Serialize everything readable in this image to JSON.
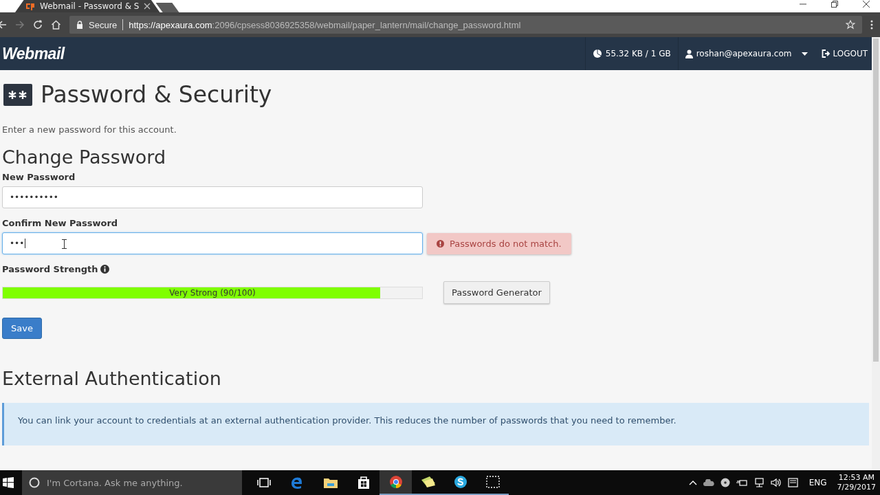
{
  "browser": {
    "tab_title": "Webmail - Password & S",
    "secure_label": "Secure",
    "url_host": "https://apexaura.com",
    "url_rest": ":2096/cpsess8036925358/webmail/paper_lantern/mail/change_password.html"
  },
  "header": {
    "logo": "Webmail",
    "quota": "55.32 KB / 1 GB",
    "user": "roshan@apexaura.com",
    "logout": "LOGOUT"
  },
  "page": {
    "title": "Password & Security",
    "intro": "Enter a new password for this account.",
    "section_title": "Change Password",
    "new_password": {
      "label": "New Password",
      "value": "••••••••••"
    },
    "confirm_password": {
      "label": "Confirm New Password",
      "value": "•••",
      "focused": true,
      "error": "Passwords do not match."
    },
    "strength": {
      "label": "Password Strength",
      "level": 0.9,
      "reading": "Very Strong (90/100)"
    },
    "generator_button": "Password Generator",
    "save_button": "Save",
    "external_title": "External Authentication",
    "external_info": "You can link your account to credentials at an external authentication provider. This reduces the number of passwords that you need to remember."
  },
  "taskbar": {
    "search_placeholder": "I'm Cortana. Ask me anything.",
    "language": "ENG",
    "time": "12:53 AM",
    "date": "7/29/2017"
  }
}
